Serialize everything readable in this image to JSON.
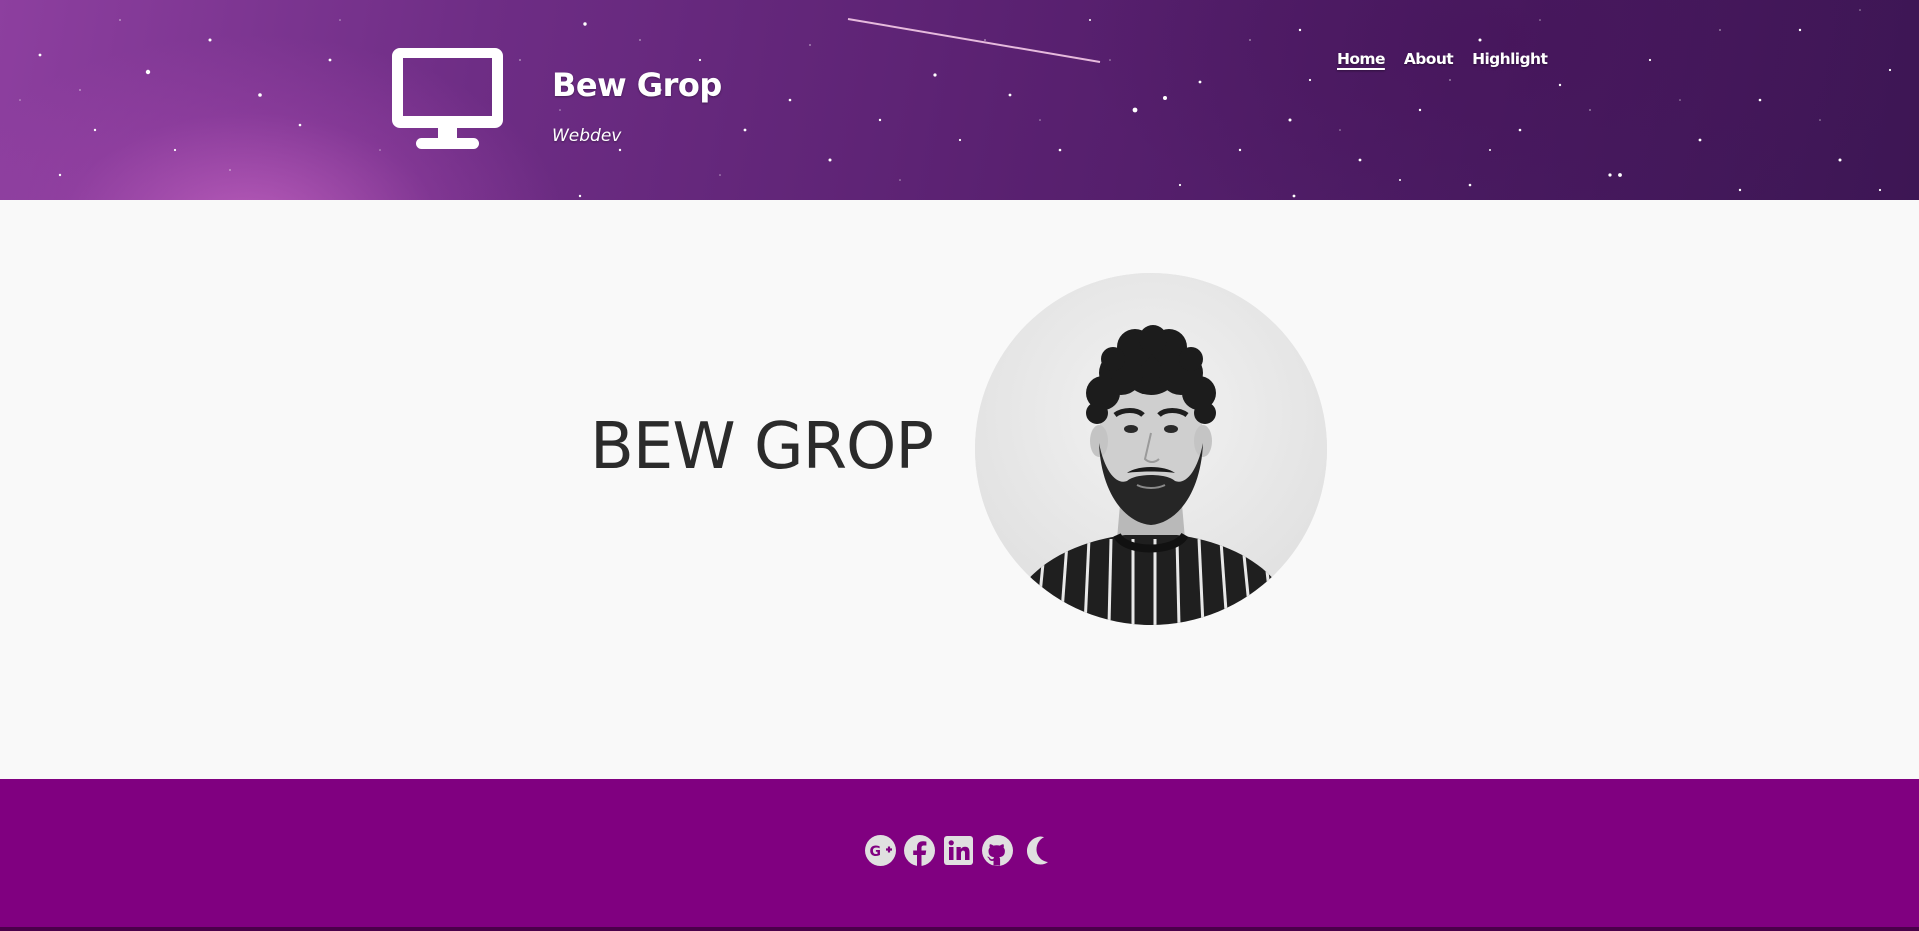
{
  "header": {
    "logo_icon": "desktop-monitor-icon",
    "site_title": "Bew Grop",
    "tagline": "Webdev"
  },
  "nav": {
    "items": [
      {
        "label": "Home",
        "active": true
      },
      {
        "label": "About",
        "active": false
      },
      {
        "label": "Highlight",
        "active": false
      }
    ]
  },
  "hero": {
    "name": "BEW GROP",
    "avatar": "profile-photo"
  },
  "footer": {
    "social_icons": [
      "google-plus-icon",
      "facebook-icon",
      "linkedin-icon",
      "github-icon",
      "dark-mode-moon-icon"
    ]
  },
  "colors": {
    "header_purple": "#58206f",
    "footer_purple": "#800080",
    "footer_icon": "#e0e0e0",
    "page_background": "#f9f9f9",
    "text_dark": "#2b2b2b"
  }
}
